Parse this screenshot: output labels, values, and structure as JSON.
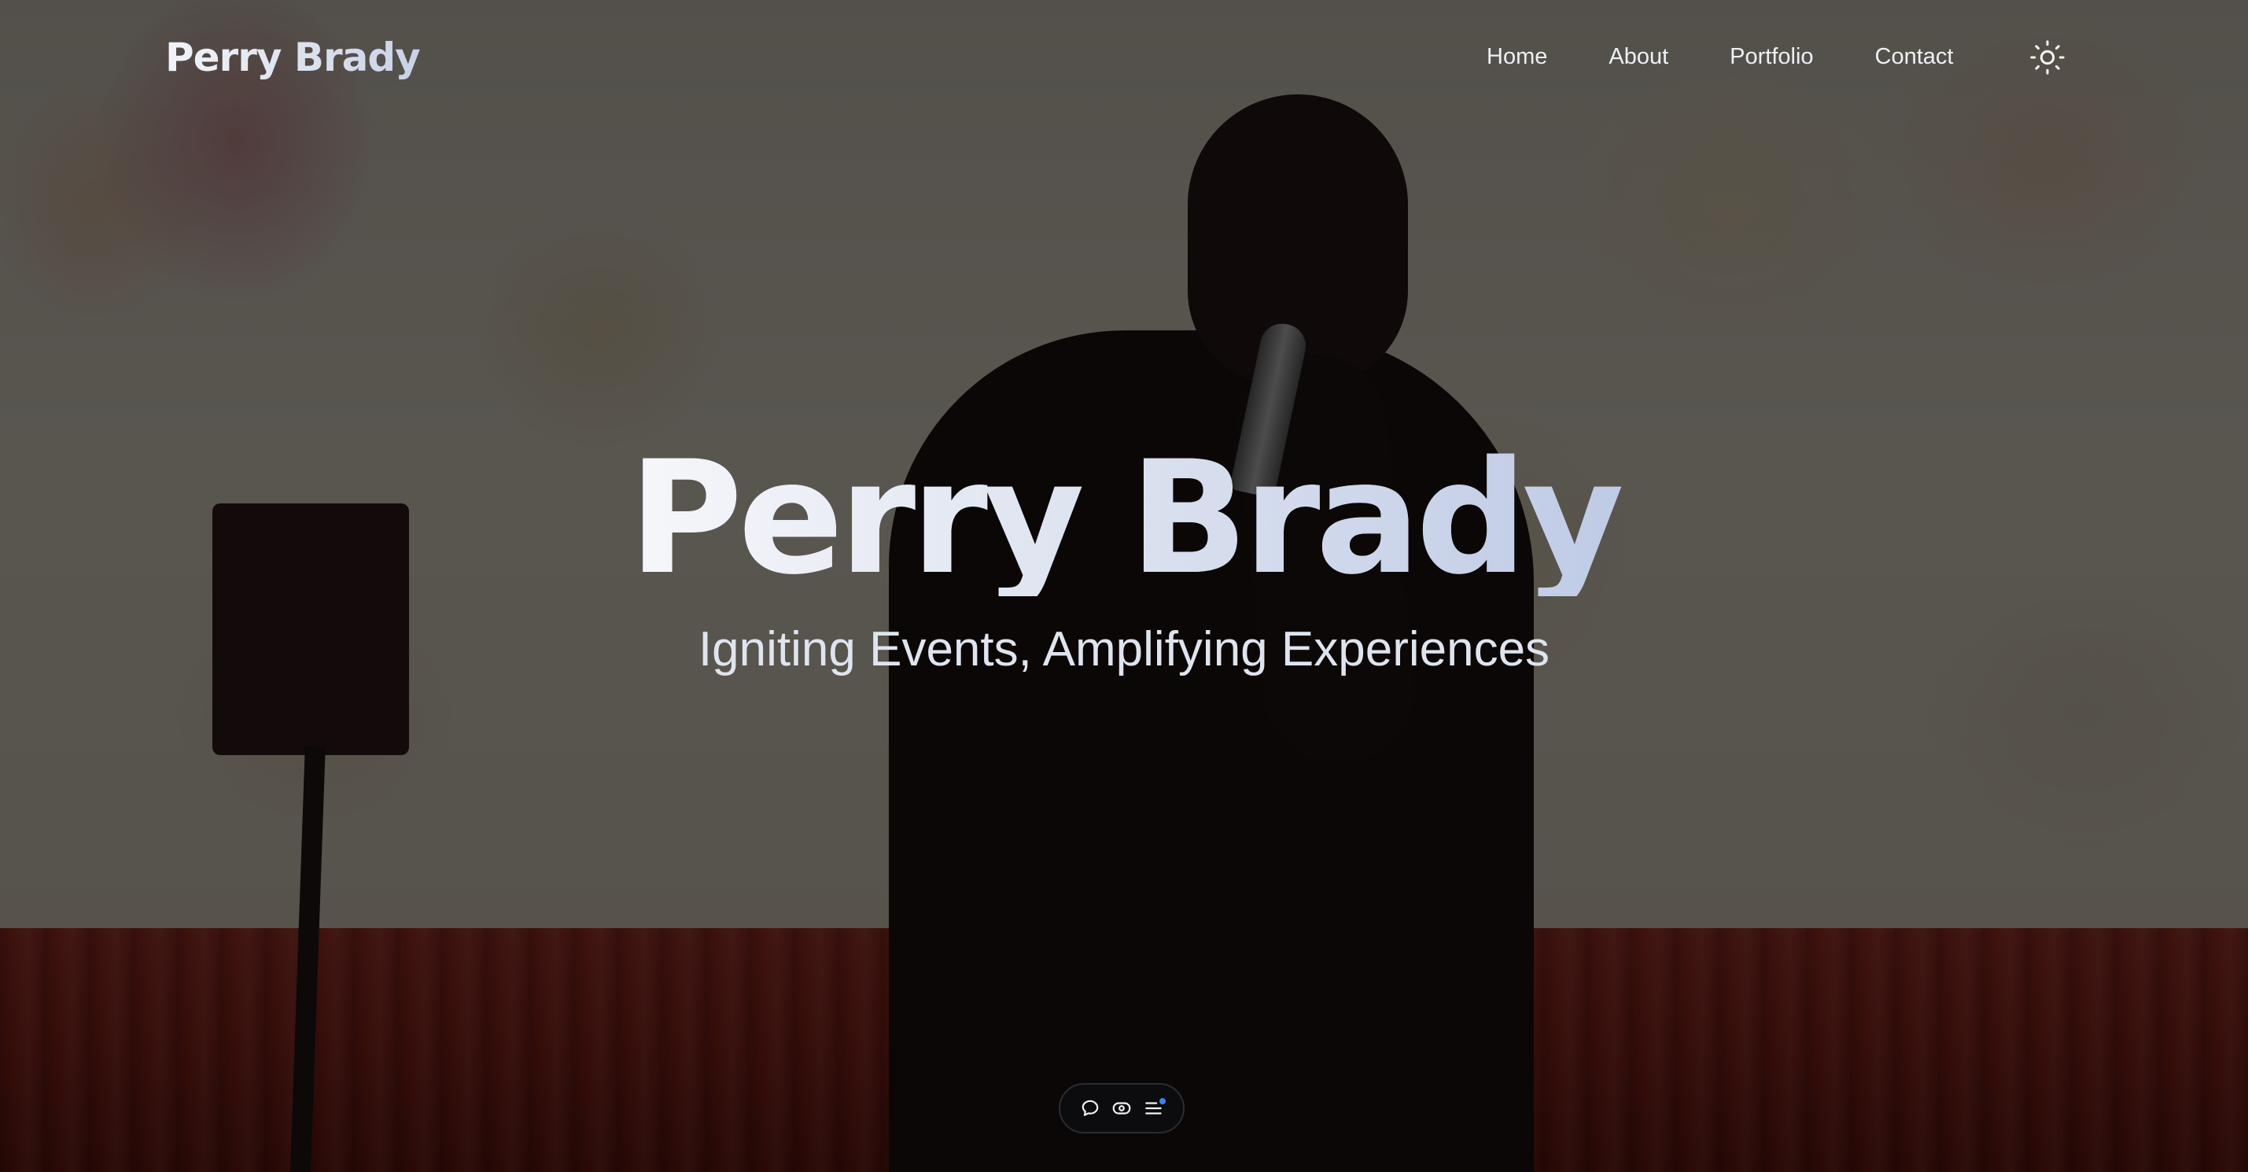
{
  "header": {
    "brand": "Perry Brady",
    "nav": [
      "Home",
      "About",
      "Portfolio",
      "Contact"
    ],
    "theme_toggle_icon": "sun-icon"
  },
  "hero": {
    "title": "Perry Brady",
    "subtitle": "Igniting Events, Amplifying Experiences",
    "background": "stage-performer-photo"
  },
  "toolbar": {
    "items": [
      {
        "icon": "comment-icon"
      },
      {
        "icon": "eye-icon"
      },
      {
        "icon": "menu-icon",
        "badge_color": "#3b82f6"
      }
    ]
  },
  "colors": {
    "text_light": "#eef0f4",
    "title_gradient_end": "#c2cde6",
    "toolbar_bg": "#0c0c0e",
    "accent": "#3b82f6"
  }
}
